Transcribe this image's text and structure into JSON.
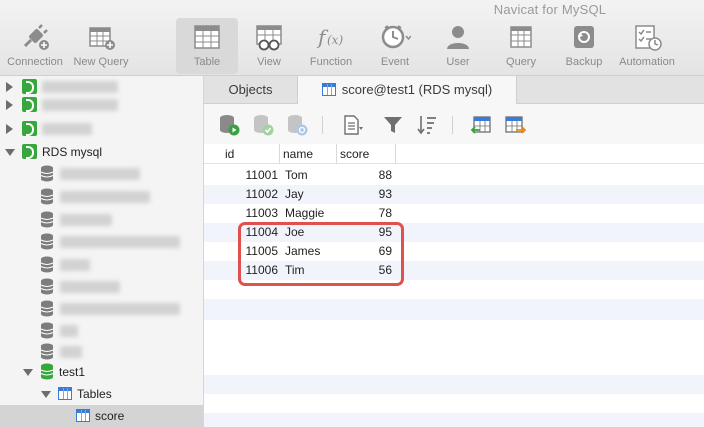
{
  "window": {
    "title": "Navicat for MySQL"
  },
  "toolbar": {
    "connection": "Connection",
    "new_query": "New Query",
    "table": "Table",
    "view": "View",
    "function": "Function",
    "event": "Event",
    "user": "User",
    "query": "Query",
    "backup": "Backup",
    "automation": "Automation",
    "active": "Table"
  },
  "sidebar": {
    "connection_name": "RDS mysql",
    "database_name": "test1",
    "tables_label": "Tables",
    "table_name": "score"
  },
  "tabs": {
    "objects": "Objects",
    "score": "score@test1 (RDS mysql)"
  },
  "grid": {
    "columns": [
      "id",
      "name",
      "score"
    ],
    "rows": [
      {
        "id": "11001",
        "name": "Tom",
        "score": "88"
      },
      {
        "id": "11002",
        "name": "Jay",
        "score": "93"
      },
      {
        "id": "11003",
        "name": "Maggie",
        "score": "78"
      },
      {
        "id": "11004",
        "name": "Joe",
        "score": "95"
      },
      {
        "id": "11005",
        "name": "James",
        "score": "69"
      },
      {
        "id": "11006",
        "name": "Tim",
        "score": "56"
      }
    ]
  },
  "colors": {
    "connection_green": "#37a63c",
    "table_blue": "#3a7bd5",
    "highlight_red": "#e0504c"
  }
}
